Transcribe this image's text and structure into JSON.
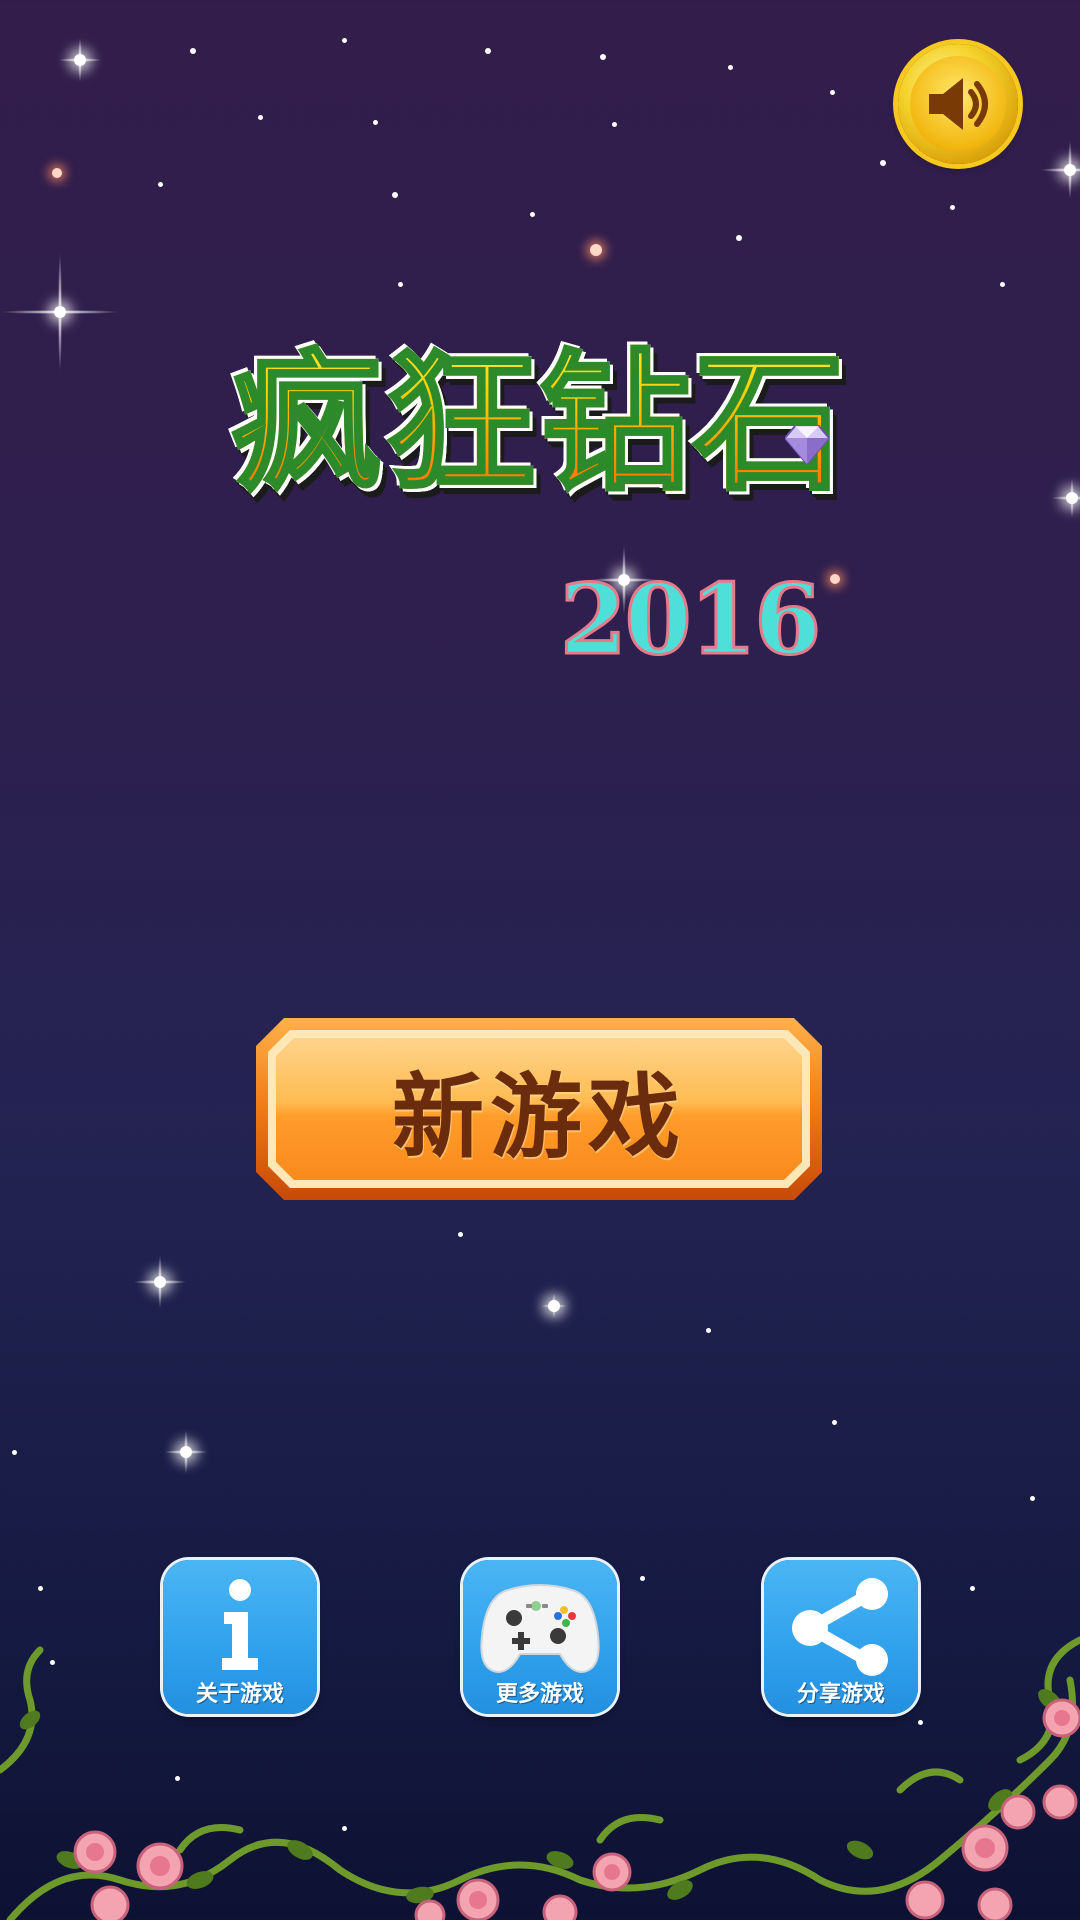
{
  "game": {
    "title": "疯狂钻石",
    "year": "2016"
  },
  "main_menu": {
    "new_game_label": "新游戏"
  },
  "bottom_menu": {
    "about_label": "关于游戏",
    "more_games_label": "更多游戏",
    "share_label": "分享游戏"
  },
  "icons": {
    "sound": "speaker-icon",
    "about": "info-icon",
    "more_games": "gamepad-icon",
    "share": "share-icon",
    "title_gem": "diamond-icon"
  },
  "colors": {
    "background_top": "#321d4b",
    "background_bottom": "#0d1233",
    "title_fill": "#ffb300",
    "year_fill": "#4ee0d8",
    "button_orange": "#f07a14",
    "menu_blue": "#2fa0ec",
    "sound_gold": "#f4d22a"
  }
}
